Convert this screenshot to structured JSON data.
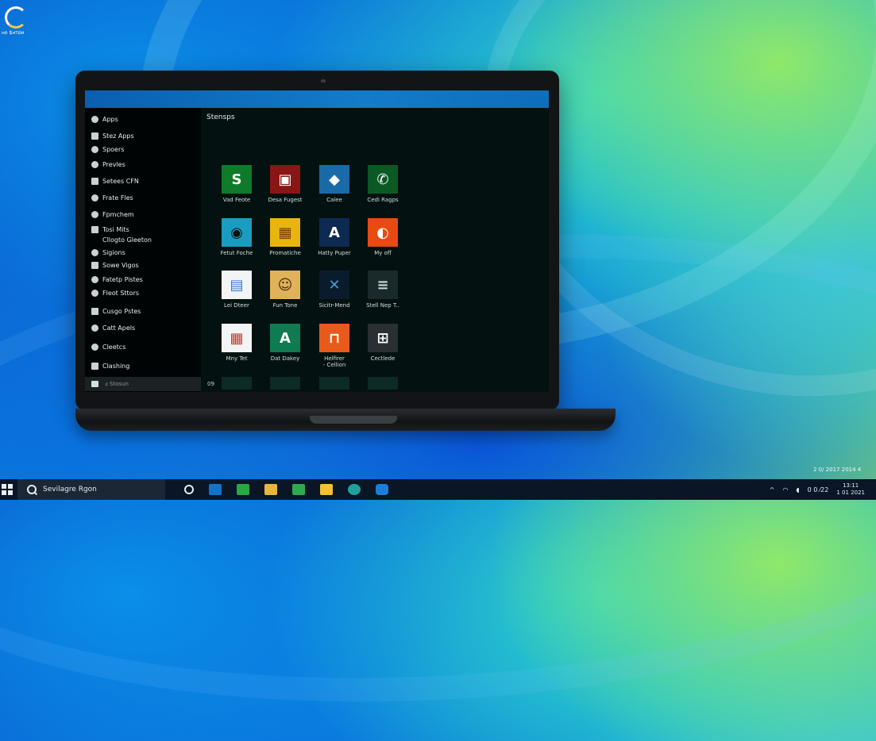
{
  "desktop": {
    "icon_label": "ʜo $ʜᴛᴇᴍ"
  },
  "start_menu": {
    "sidebar": [
      {
        "label": "Apps",
        "icon": "apps-icon"
      },
      {
        "label": "Stez Apps",
        "icon": "store-icon"
      },
      {
        "label": "Spoers",
        "icon": "sports-icon"
      },
      {
        "label": "Prevles",
        "icon": "profiles-icon"
      },
      {
        "label": "Setees CFN",
        "icon": "settings-icon"
      },
      {
        "label": "Frate Fles",
        "icon": "files-icon"
      },
      {
        "label": "Fpmchem",
        "icon": "apps-icon"
      },
      {
        "label": "Tosi Mits",
        "icon": "tools-icon"
      },
      {
        "label": "Cllogto Gleeton",
        "icon": "none"
      },
      {
        "label": "Sigions",
        "icon": "settings-icon"
      },
      {
        "label": "Sowe Vigos",
        "icon": "video-icon"
      },
      {
        "label": "Fatetp Pistes",
        "icon": "photos-icon"
      },
      {
        "label": "Fleot Sttors",
        "icon": "store-icon"
      },
      {
        "label": "Cusgo Pstes",
        "icon": "files-icon"
      },
      {
        "label": "Catt Apels",
        "icon": "apps-icon"
      },
      {
        "label": "Cleetcs",
        "icon": "files-icon"
      },
      {
        "label": "Clashing",
        "icon": "files-icon"
      }
    ],
    "sidebar_bottom": "ⅎ Stosun",
    "pane_title": "Stensps",
    "pager": "09",
    "tiles": [
      {
        "label": "Vad Feote",
        "icon": "sheets-icon",
        "glyph": "S"
      },
      {
        "label": "Desa Fugest",
        "icon": "media-icon",
        "glyph": "▣"
      },
      {
        "label": "Calee",
        "icon": "photos-icon",
        "glyph": "◆"
      },
      {
        "label": "Cedi Ragps",
        "icon": "whatsapp-icon",
        "glyph": "✆"
      },
      {
        "label": "Fetut Foche",
        "icon": "camera-icon",
        "glyph": "◉"
      },
      {
        "label": "Promatiche",
        "icon": "gallery-icon",
        "glyph": "▦"
      },
      {
        "label": "Hatty Puper",
        "icon": "font-icon",
        "glyph": "A"
      },
      {
        "label": "My off",
        "icon": "orange-app-icon",
        "glyph": "◐"
      },
      {
        "label": "Lei Dteer",
        "icon": "docs-icon",
        "glyph": "▤"
      },
      {
        "label": "Fun Tone",
        "icon": "avatar-icon",
        "glyph": "☺"
      },
      {
        "label": "Sicitr-Mend",
        "icon": "xbox-icon",
        "glyph": "✕"
      },
      {
        "label": "Stell Nep T..",
        "icon": "notepad-icon",
        "glyph": "≡"
      },
      {
        "label": "Mny Tet",
        "icon": "calendar-icon",
        "glyph": "▦"
      },
      {
        "label": "Dat Dakey",
        "icon": "appstore-icon",
        "glyph": "A"
      },
      {
        "label": "Helfirer\n- Cellion",
        "icon": "office-icon",
        "glyph": "⊓"
      },
      {
        "label": "Cectlede",
        "icon": "windows-icon",
        "glyph": "⊞"
      }
    ]
  },
  "taskbar": {
    "search_text": "Sevilagre Rgon",
    "tray_time": "0 0 ⁄22",
    "clock_line1": "13:11",
    "clock_line2": "1 01 2021",
    "floating_date": "2 0/ 2017 2014 4"
  },
  "colors": {
    "tile_green": "#0f7a2a",
    "tile_red": "#8a1515",
    "tile_blue": "#1b6aa8",
    "tile_darkgreen": "#0b5a24",
    "tile_teal": "#1a9cc0",
    "tile_yellow": "#e8b50e",
    "tile_navy": "#0d2a52",
    "tile_orange": "#e84a12"
  }
}
